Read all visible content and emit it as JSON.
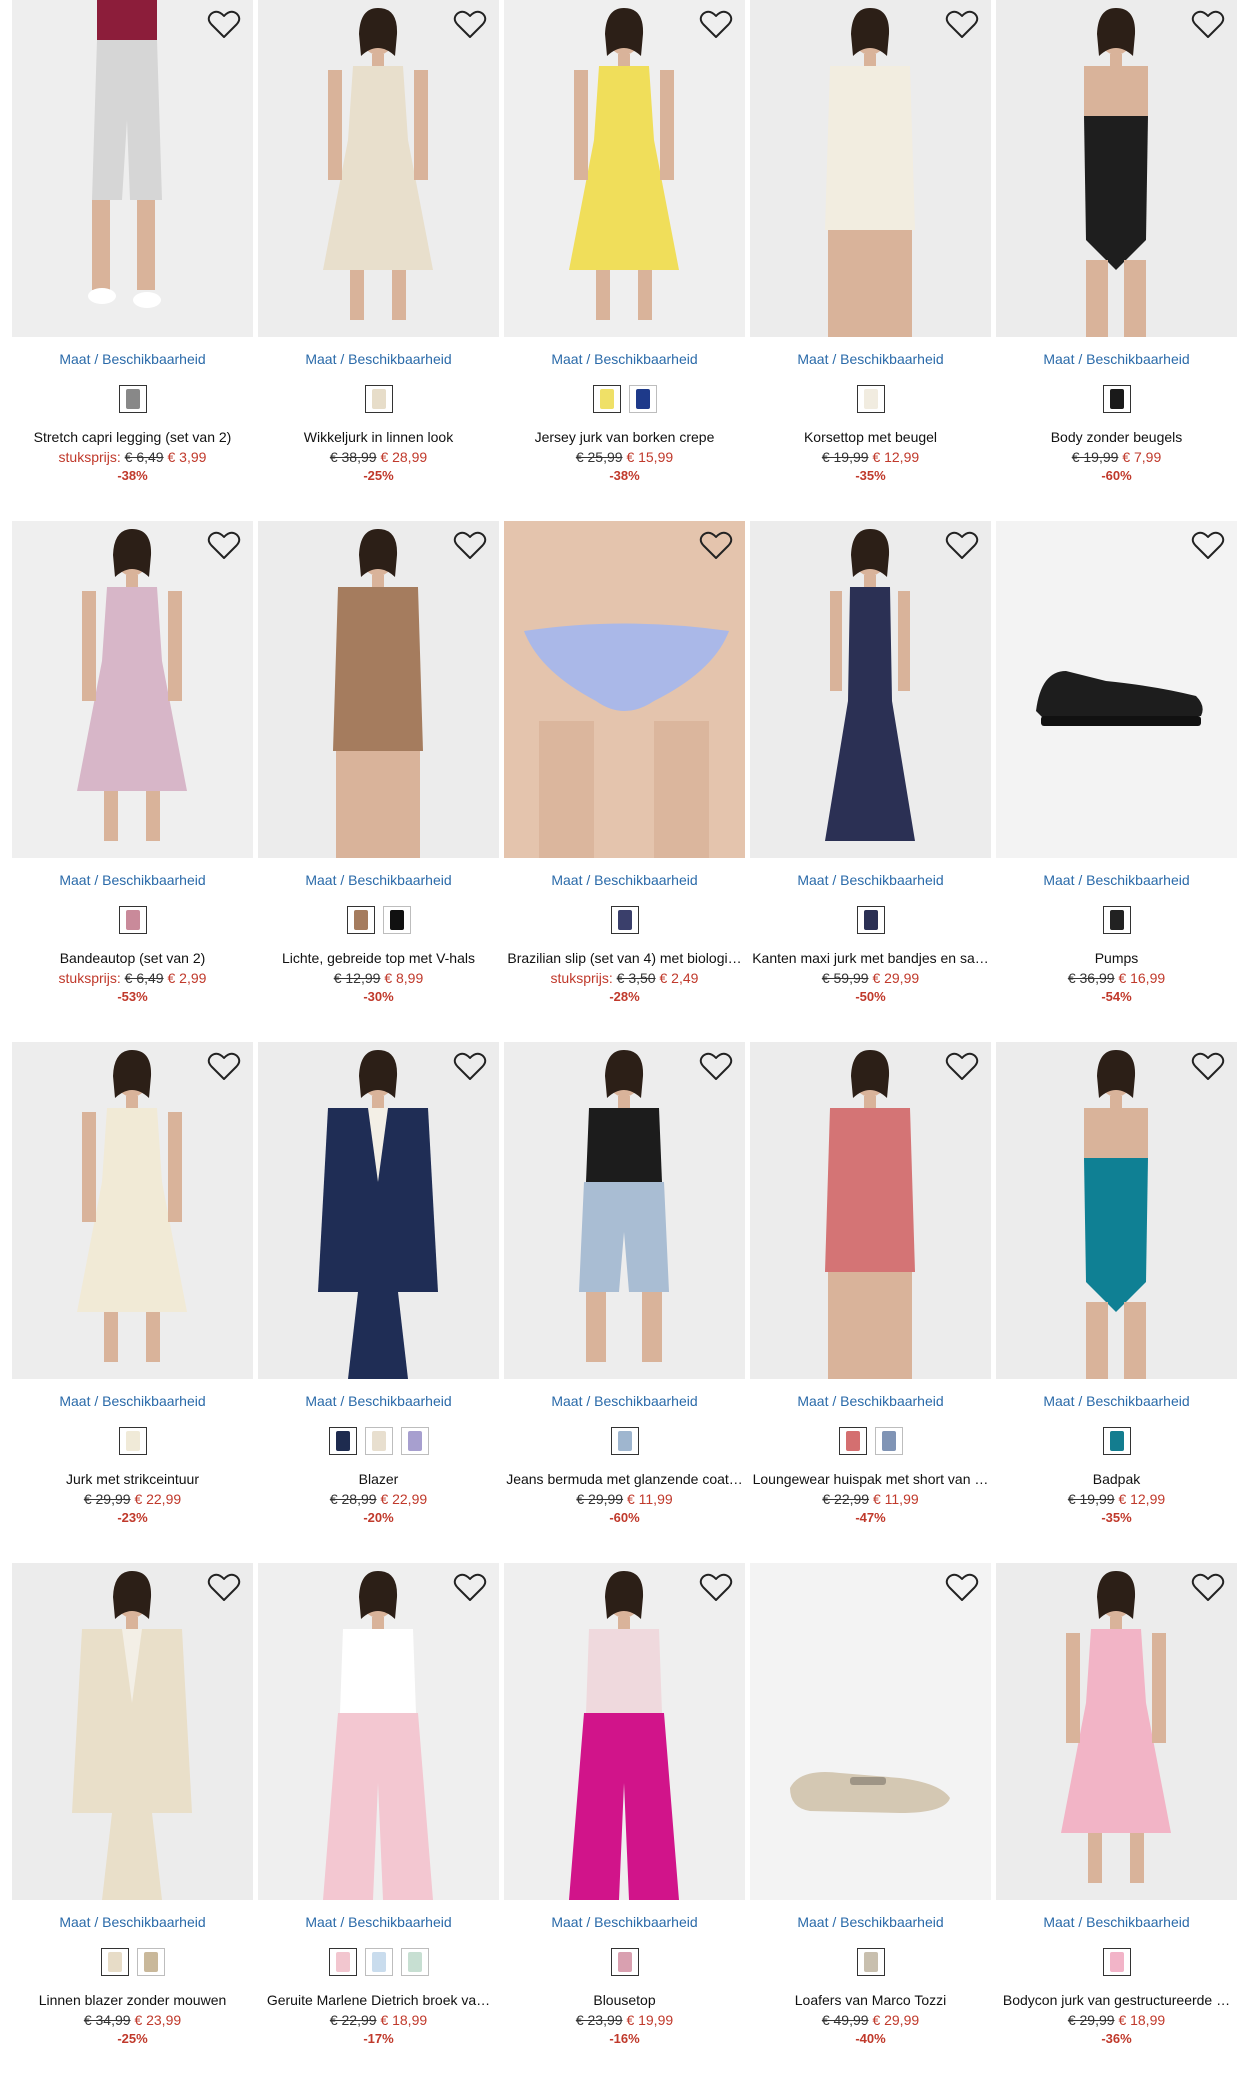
{
  "availability_label": "Maat / Beschikbaarheid",
  "colors": {
    "link": "#2a6aa9",
    "sale": "#c0392b"
  },
  "products": [
    {
      "name": "Stretch capri legging (set van 2)",
      "unit_label": "stuksprijs:",
      "old_price": "€ 6,49",
      "price": "€ 3,99",
      "discount": "-38%",
      "swatches": [
        "#888888"
      ],
      "icon": "heart-icon"
    },
    {
      "name": "Wikkeljurk in linnen look",
      "unit_label": "",
      "old_price": "€ 38,99",
      "price": "€ 28,99",
      "discount": "-25%",
      "swatches": [
        "#e7ddc9"
      ],
      "icon": "heart-icon"
    },
    {
      "name": "Jersey jurk van borken crepe",
      "unit_label": "",
      "old_price": "€ 25,99",
      "price": "€ 15,99",
      "discount": "-38%",
      "swatches": [
        "#efe067",
        "#1e3a8a"
      ],
      "icon": "heart-icon"
    },
    {
      "name": "Korsettop met beugel",
      "unit_label": "",
      "old_price": "€ 19,99",
      "price": "€ 12,99",
      "discount": "-35%",
      "swatches": [
        "#f1ece0"
      ],
      "icon": "heart-icon"
    },
    {
      "name": "Body zonder beugels",
      "unit_label": "",
      "old_price": "€ 19,99",
      "price": "€ 7,99",
      "discount": "-60%",
      "swatches": [
        "#1a1a1a"
      ],
      "icon": "heart-icon"
    },
    {
      "name": "Bandeautop (set van 2)",
      "unit_label": "stuksprijs:",
      "old_price": "€ 6,49",
      "price": "€ 2,99",
      "discount": "-53%",
      "swatches": [
        "#c98a9a"
      ],
      "icon": "heart-icon"
    },
    {
      "name": "Lichte, gebreide top met V-hals",
      "unit_label": "",
      "old_price": "€ 12,99",
      "price": "€ 8,99",
      "discount": "-30%",
      "swatches": [
        "#a57c5e",
        "#111111"
      ],
      "icon": "heart-icon"
    },
    {
      "name": "Brazilian slip (set van 4) met biologi…",
      "unit_label": "stuksprijs:",
      "old_price": "€ 3,50",
      "price": "€ 2,49",
      "discount": "-28%",
      "swatches": [
        "#3a3f6b"
      ],
      "icon": "heart-icon"
    },
    {
      "name": "Kanten maxi jurk met bandjes en sa…",
      "unit_label": "",
      "old_price": "€ 59,99",
      "price": "€ 29,99",
      "discount": "-50%",
      "swatches": [
        "#2b3054"
      ],
      "icon": "heart-icon"
    },
    {
      "name": "Pumps",
      "unit_label": "",
      "old_price": "€ 36,99",
      "price": "€ 16,99",
      "discount": "-54%",
      "swatches": [
        "#222222"
      ],
      "icon": "heart-icon"
    },
    {
      "name": "Jurk met strikceintuur",
      "unit_label": "",
      "old_price": "€ 29,99",
      "price": "€ 22,99",
      "discount": "-23%",
      "swatches": [
        "#f0ead8"
      ],
      "icon": "heart-icon"
    },
    {
      "name": "Blazer",
      "unit_label": "",
      "old_price": "€ 28,99",
      "price": "€ 22,99",
      "discount": "-20%",
      "swatches": [
        "#1e2b4f",
        "#e8dfcf",
        "#a79fcf"
      ],
      "icon": "heart-icon"
    },
    {
      "name": "Jeans bermuda met glanzende coat…",
      "unit_label": "",
      "old_price": "€ 29,99",
      "price": "€ 11,99",
      "discount": "-60%",
      "swatches": [
        "#9fb6cf"
      ],
      "icon": "heart-icon"
    },
    {
      "name": "Loungewear huispak met short van …",
      "unit_label": "",
      "old_price": "€ 22,99",
      "price": "€ 11,99",
      "discount": "-47%",
      "swatches": [
        "#d46f70",
        "#8094b5"
      ],
      "icon": "heart-icon"
    },
    {
      "name": "Badpak",
      "unit_label": "",
      "old_price": "€ 19,99",
      "price": "€ 12,99",
      "discount": "-35%",
      "swatches": [
        "#137d8f"
      ],
      "icon": "heart-icon"
    },
    {
      "name": "Linnen blazer zonder mouwen",
      "unit_label": "",
      "old_price": "€ 34,99",
      "price": "€ 23,99",
      "discount": "-25%",
      "swatches": [
        "#e7dcc7",
        "#c9b89a"
      ],
      "icon": "heart-icon"
    },
    {
      "name": "Geruite Marlene Dietrich broek va…",
      "unit_label": "",
      "old_price": "€ 22,99",
      "price": "€ 18,99",
      "discount": "-17%",
      "swatches": [
        "#f2c6cf",
        "#c9dced",
        "#c7dfd2"
      ],
      "icon": "heart-icon"
    },
    {
      "name": "Blousetop",
      "unit_label": "",
      "old_price": "€ 23,99",
      "price": "€ 19,99",
      "discount": "-16%",
      "swatches": [
        "#d9a0b0"
      ],
      "icon": "heart-icon"
    },
    {
      "name": "Loafers van Marco Tozzi",
      "unit_label": "",
      "old_price": "€ 49,99",
      "price": "€ 29,99",
      "discount": "-40%",
      "swatches": [
        "#c8bfae"
      ],
      "icon": "heart-icon"
    },
    {
      "name": "Bodycon jurk van gestructureerde …",
      "unit_label": "",
      "old_price": "€ 29,99",
      "price": "€ 18,99",
      "discount": "-36%",
      "swatches": [
        "#f2b4c8"
      ],
      "icon": "heart-icon"
    }
  ]
}
